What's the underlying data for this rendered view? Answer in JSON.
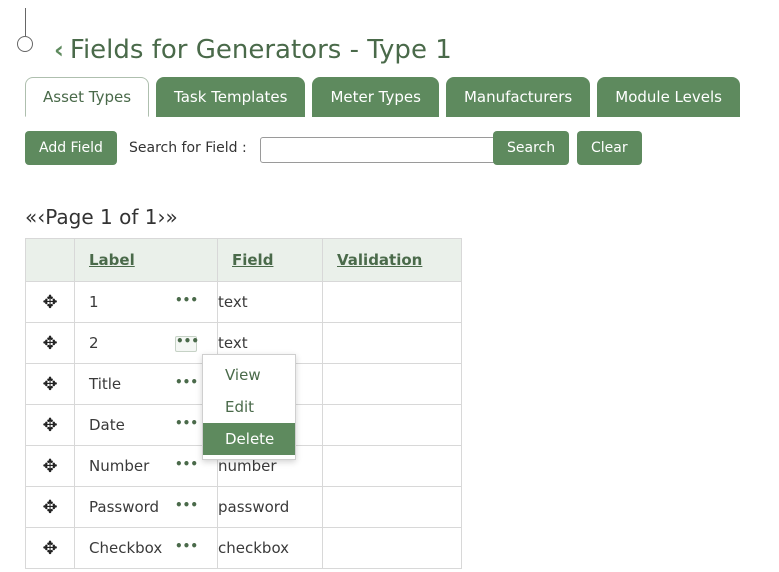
{
  "header": {
    "back_glyph": "‹",
    "title": "Fields for Generators - Type 1"
  },
  "tabs": [
    {
      "label": "Asset Types",
      "active": true
    },
    {
      "label": "Task Templates",
      "active": false
    },
    {
      "label": "Meter Types",
      "active": false
    },
    {
      "label": "Manufacturers",
      "active": false
    },
    {
      "label": "Module Levels",
      "active": false
    }
  ],
  "toolbar": {
    "add_field_label": "Add Field",
    "search_label": "Search for Field :",
    "search_value": "",
    "search_button": "Search",
    "clear_button": "Clear"
  },
  "pager": {
    "first": "«",
    "prev": "‹",
    "text": "Page 1 of 1",
    "next": "›",
    "last": "»"
  },
  "table": {
    "columns": [
      "Label",
      "Field",
      "Validation"
    ],
    "rows": [
      {
        "label": "1",
        "field": "text",
        "validation": ""
      },
      {
        "label": "2",
        "field": "text",
        "validation": ""
      },
      {
        "label": "Title",
        "field": "",
        "validation": ""
      },
      {
        "label": "Date",
        "field": "",
        "validation": ""
      },
      {
        "label": "Number",
        "field": "number",
        "validation": ""
      },
      {
        "label": "Password",
        "field": "password",
        "validation": ""
      },
      {
        "label": "Checkbox",
        "field": "checkbox",
        "validation": ""
      }
    ]
  },
  "context_menu": {
    "items": [
      "View",
      "Edit",
      "Delete"
    ],
    "highlighted": "Delete"
  },
  "colors": {
    "accent": "#5e8a5e",
    "title": "#4a6a4a"
  },
  "icons": {
    "move": "move-icon",
    "more": "more-dots-icon"
  }
}
